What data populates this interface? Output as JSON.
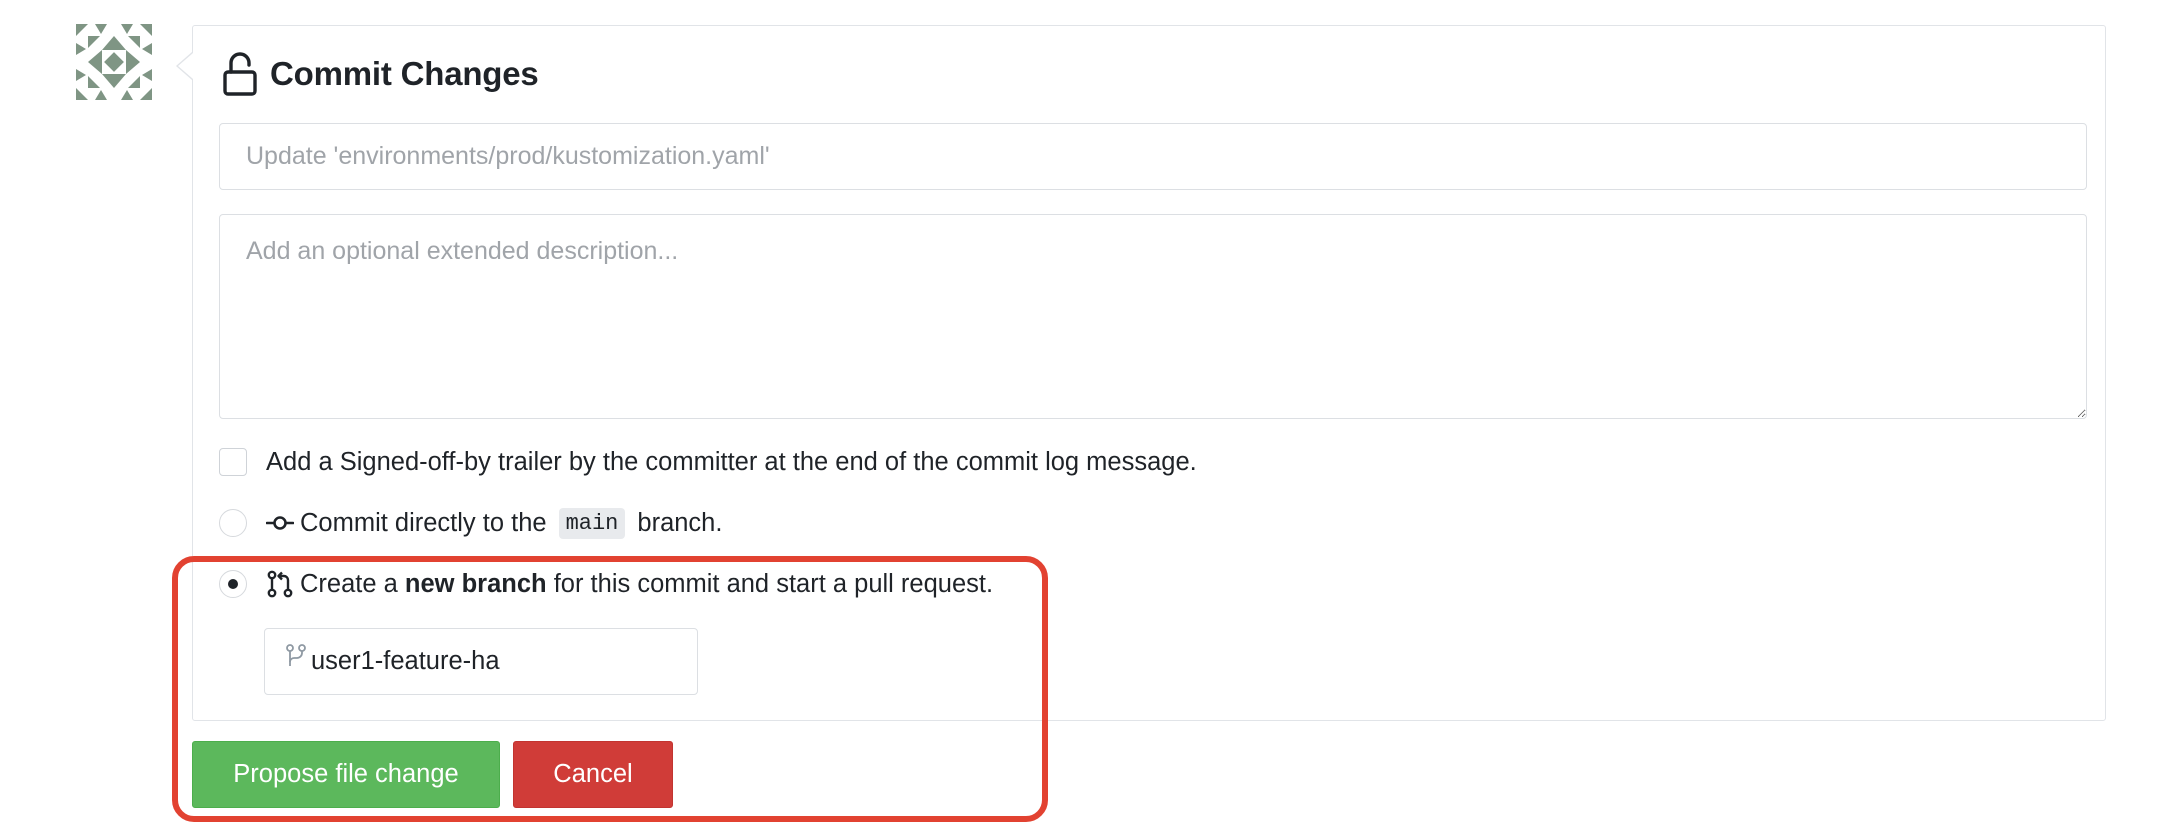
{
  "commit_form": {
    "title": "Commit Changes",
    "summary_placeholder": "Update 'environments/prod/kustomization.yaml'",
    "summary_value": "",
    "description_placeholder": "Add an optional extended description...",
    "description_value": "",
    "signoff_label": "Add a Signed-off-by trailer by the committer at the end of the commit log message.",
    "signoff_checked": false,
    "direct_option": {
      "prefix": "Commit directly to the",
      "branch": "main",
      "suffix": "branch.",
      "selected": false
    },
    "new_branch_option": {
      "prefix": "Create a",
      "emphasis": "new branch",
      "suffix": "for this commit and start a pull request.",
      "selected": true
    },
    "new_branch_name": "user1-feature-ha",
    "propose_label": "Propose file change",
    "cancel_label": "Cancel"
  },
  "colors": {
    "propose_button": "#5cb85c",
    "cancel_button": "#d03c38",
    "highlight_annotation": "#e24231"
  },
  "icons": {
    "avatar": "identicon-avatar",
    "title": "unlock-icon",
    "direct_option": "git-commit-icon",
    "new_branch_option": "git-pull-request-icon",
    "branch_field": "git-branch-icon"
  }
}
